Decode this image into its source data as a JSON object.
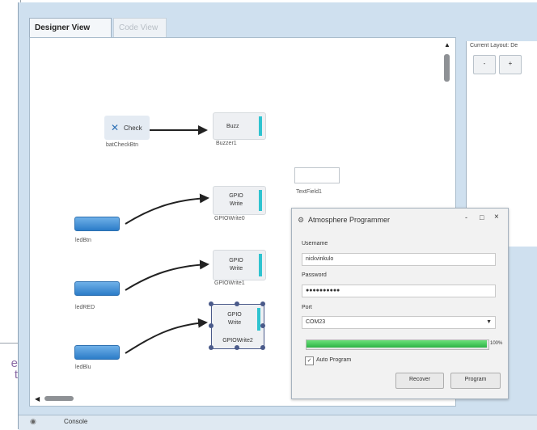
{
  "left_edge_text": "e\nt",
  "tabs": [
    {
      "label": "Designer View"
    },
    {
      "label": "Code View"
    }
  ],
  "nodes": {
    "check": {
      "label": "Check",
      "caption": "batCheckBtn"
    },
    "buzzer": {
      "label": "Buzz",
      "caption": "Buzzer1"
    },
    "textfield": {
      "caption": "TextField1"
    },
    "gpio1": {
      "line1": "GPIO",
      "line2": "Write",
      "caption": "GPIOWrite0"
    },
    "gpio2": {
      "line1": "GPIO",
      "line2": "Write",
      "caption": "GPIOWrite1"
    },
    "gpio3": {
      "line1": "GPIO",
      "line2": "Write",
      "caption": "GPIOWrite2"
    },
    "btn1": {
      "caption": "ledBtn"
    },
    "btn2": {
      "caption": "ledRED"
    },
    "btn3": {
      "caption": "ledBlu"
    }
  },
  "right_panel": {
    "title": "Current Layout: De",
    "buttons": [
      "-",
      "+"
    ]
  },
  "dialog": {
    "title": "Atmosphere Programmer",
    "username_label": "Username",
    "username_value": "nickvinkulo",
    "password_label": "Password",
    "password_value": "●●●●●●●●●●",
    "port_label": "Port",
    "port_value": "COM23",
    "progress": 1.0,
    "progress_text": "100%",
    "auto_program_label": "Auto Program",
    "auto_program_checked": true,
    "recover_label": "Recover",
    "program_label": "Program",
    "window_icons": [
      "-",
      "□",
      "×"
    ]
  },
  "console": {
    "label": "Console"
  },
  "colors": {
    "app_bg": "#cfe0ef",
    "accent_bar": "#2fc3d0",
    "button_blue": "#2c7cc8",
    "progress_green": "#2db446"
  }
}
